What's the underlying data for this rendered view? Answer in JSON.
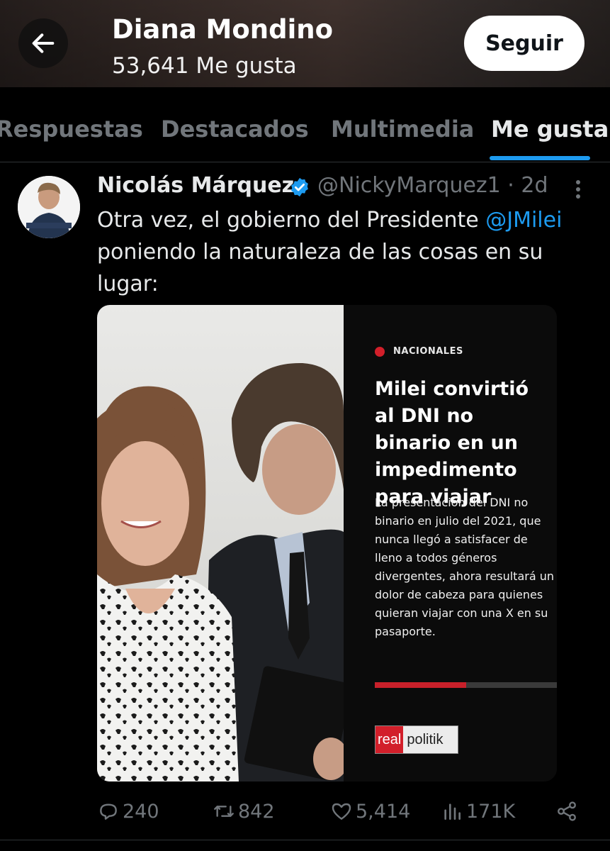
{
  "header": {
    "title": "Diana Mondino",
    "subtitle": "53,641 Me gusta",
    "follow_label": "Seguir"
  },
  "tabs": [
    {
      "label": "Respuestas"
    },
    {
      "label": "Destacados"
    },
    {
      "label": "Multimedia"
    },
    {
      "label": "Me gusta",
      "active": true
    }
  ],
  "tweet": {
    "author_name": "Nicolás Márquez",
    "handle_time": "@NickyMarquez1 · 2d",
    "text_before": "Otra vez, el gobierno del Presidente ",
    "mention": "@JMilei",
    "text_after": " poniendo la naturaleza de las cosas en su lugar:",
    "article": {
      "category": "NACIONALES",
      "headline": "Milei convirtió al DNI no binario en un impedimento para viajar",
      "summary": "La presentación del DNI no binario en julio del 2021, que nunca llegó a satisfacer de lleno a todos géneros divergentes, ahora resultará un dolor de cabeza para quienes quieran viajar con una X en su pasaporte.",
      "progress_fraction": 0.5,
      "logo_part1": "real",
      "logo_part2": "politik"
    },
    "actions": {
      "replies": "240",
      "retweets": "842",
      "likes": "5,414",
      "views": "171K"
    }
  },
  "colors": {
    "accent": "#1d9bf0",
    "muted": "#71767b",
    "brand_red": "#d21f2a"
  }
}
